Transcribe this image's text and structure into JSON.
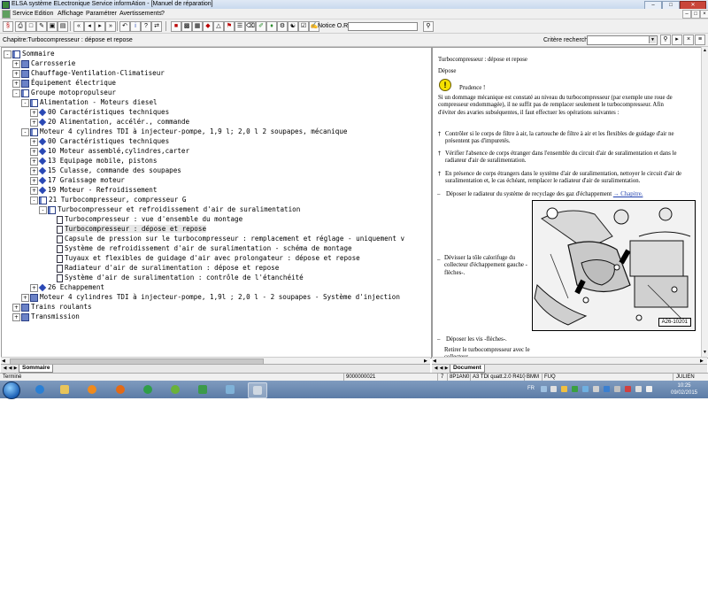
{
  "window": {
    "title": "ELSA système ELectronique Service informAtion - [Manuel de réparation]"
  },
  "menu": [
    "Service",
    "Edition",
    "Affichage",
    "Paramétrer",
    "Avertissements",
    "?"
  ],
  "toolbar": {
    "notice_label": "Notice O.R.:",
    "notice_value": ""
  },
  "chapter_bar": {
    "chapter": "Chapitre:Turbocompresseur : dépose et repose",
    "criteria_label": "Critère recherche:",
    "criteria_value": ""
  },
  "tree": [
    {
      "label": "Sommaire",
      "level": 0,
      "expander": "-",
      "icon": "open-book-icon"
    },
    {
      "label": "Carrosserie",
      "level": 1,
      "expander": "+",
      "icon": "book-icon"
    },
    {
      "label": "Chauffage-Ventilation-Climatiseur",
      "level": 1,
      "expander": "+",
      "icon": "book-icon"
    },
    {
      "label": "Équipement électrique",
      "level": 1,
      "expander": "+",
      "icon": "book-icon"
    },
    {
      "label": "Groupe motopropulseur",
      "level": 1,
      "expander": "-",
      "icon": "open-book-icon"
    },
    {
      "label": "Alimentation - Moteurs diesel",
      "level": 2,
      "expander": "-",
      "icon": "open-book-icon"
    },
    {
      "label": "00 Caractéristiques techniques",
      "level": 3,
      "expander": "+",
      "icon": "diamond-icon"
    },
    {
      "label": "20 Alimentation, accélér., commande",
      "level": 3,
      "expander": "+",
      "icon": "diamond-icon"
    },
    {
      "label": "Moteur 4 cylindres TDI à injecteur-pompe, 1,9 l; 2,0 l 2 soupapes, mécanique",
      "level": 2,
      "expander": "-",
      "icon": "open-book-icon"
    },
    {
      "label": "00 Caractéristiques techniques",
      "level": 3,
      "expander": "+",
      "icon": "diamond-icon"
    },
    {
      "label": "10 Moteur assemblé,cylindres,carter",
      "level": 3,
      "expander": "+",
      "icon": "diamond-icon"
    },
    {
      "label": "13 Equipage mobile, pistons",
      "level": 3,
      "expander": "+",
      "icon": "diamond-icon"
    },
    {
      "label": "15 Culasse, commande des soupapes",
      "level": 3,
      "expander": "+",
      "icon": "diamond-icon"
    },
    {
      "label": "17 Graissage moteur",
      "level": 3,
      "expander": "+",
      "icon": "diamond-icon"
    },
    {
      "label": "19 Moteur - Refroidissement",
      "level": 3,
      "expander": "+",
      "icon": "diamond-icon"
    },
    {
      "label": "21 Turbocompresseur, compresseur G",
      "level": 3,
      "expander": "-",
      "icon": "open-book-icon"
    },
    {
      "label": "Turbocompresseur et refroidissement d'air de suralimentation",
      "level": 4,
      "expander": "-",
      "icon": "open-book-icon"
    },
    {
      "label": "Turbocompresseur : vue d'ensemble du montage",
      "level": 5,
      "expander": "",
      "icon": "page-icon"
    },
    {
      "label": "Turbocompresseur : dépose et repose",
      "level": 5,
      "expander": "",
      "icon": "page-icon",
      "selected": true
    },
    {
      "label": "Capsule de pression sur le turbocompresseur : remplacement et réglage - uniquement v",
      "level": 5,
      "expander": "",
      "icon": "page-icon"
    },
    {
      "label": "Système de refroidissement d'air de suralimentation - schéma de montage",
      "level": 5,
      "expander": "",
      "icon": "page-icon"
    },
    {
      "label": "Tuyaux et flexibles de guidage d'air avec prolongateur : dépose et repose",
      "level": 5,
      "expander": "",
      "icon": "page-icon"
    },
    {
      "label": "Radiateur d'air de suralimentation : dépose et repose",
      "level": 5,
      "expander": "",
      "icon": "page-icon"
    },
    {
      "label": "Système d'air de suralimentation : contrôle de l'étanchéité",
      "level": 5,
      "expander": "",
      "icon": "page-icon"
    },
    {
      "label": "26 Echappement",
      "level": 3,
      "expander": "+",
      "icon": "diamond-icon"
    },
    {
      "label": "Moteur 4 cylindres TDI à injecteur-pompe, 1,9l ; 2,0 l - 2 soupapes - Système d'injection",
      "level": 2,
      "expander": "+",
      "icon": "book-icon"
    },
    {
      "label": "Trains roulants",
      "level": 1,
      "expander": "+",
      "icon": "book-icon"
    },
    {
      "label": "Transmission",
      "level": 1,
      "expander": "+",
      "icon": "book-icon"
    }
  ],
  "left_tab": "Sommaire",
  "right_tab": "Document",
  "document": {
    "title": "Turbocompresseur : dépose et repose",
    "section": "Dépose",
    "caution": "Prudence !",
    "caution_text": "Si un dommage mécanique est constaté au niveau du turbocompresseur (par exemple une roue de compresseur endommagée), il ne suffit pas de remplacer seulement le turbocompresseur. Afin d'éviter des avaries subséquentes, il faut effectuer les opérations suivantes :",
    "checks": [
      "Contrôler si le corps de filtre à air, la cartouche de filtre à air et les flexibles de guidage d'air ne présentent pas d'impuretés.",
      "Vérifier l'absence de corps étranger dans l'ensemble du circuit d'air de suralimentation et dans le radiateur d'air de suralimentation.",
      "En présence de corps étrangers dans le système d'air de suralimentation, nettoyer le circuit d'air de suralimentation et, le cas échéant, remplacer le radiateur d'air de suralimentation."
    ],
    "step1": "Déposer le radiateur du système de recyclage des gaz d'échappement",
    "step1_link": "→ Chapitre.",
    "step2": "Dévisser la tôle calorifuge du collecteur d'échappement gauche -flèches-.",
    "figure_label": "A26-10201",
    "step3": "Déposer les vis -flèches-.",
    "step4": "Retirer le turbocompresseur avec le collecteur"
  },
  "status": {
    "left": "Terminé",
    "code": "9000000021",
    "num": "7",
    "vehicle": "8P1AN0",
    "model": "A3 TDI quatt.2.0 R410",
    "engine": "BMM",
    "gearbox": "FUQ",
    "user": "JULIEN"
  },
  "taskbar": {
    "lang": "FR",
    "time": "10:25",
    "date": "09/02/2015"
  }
}
